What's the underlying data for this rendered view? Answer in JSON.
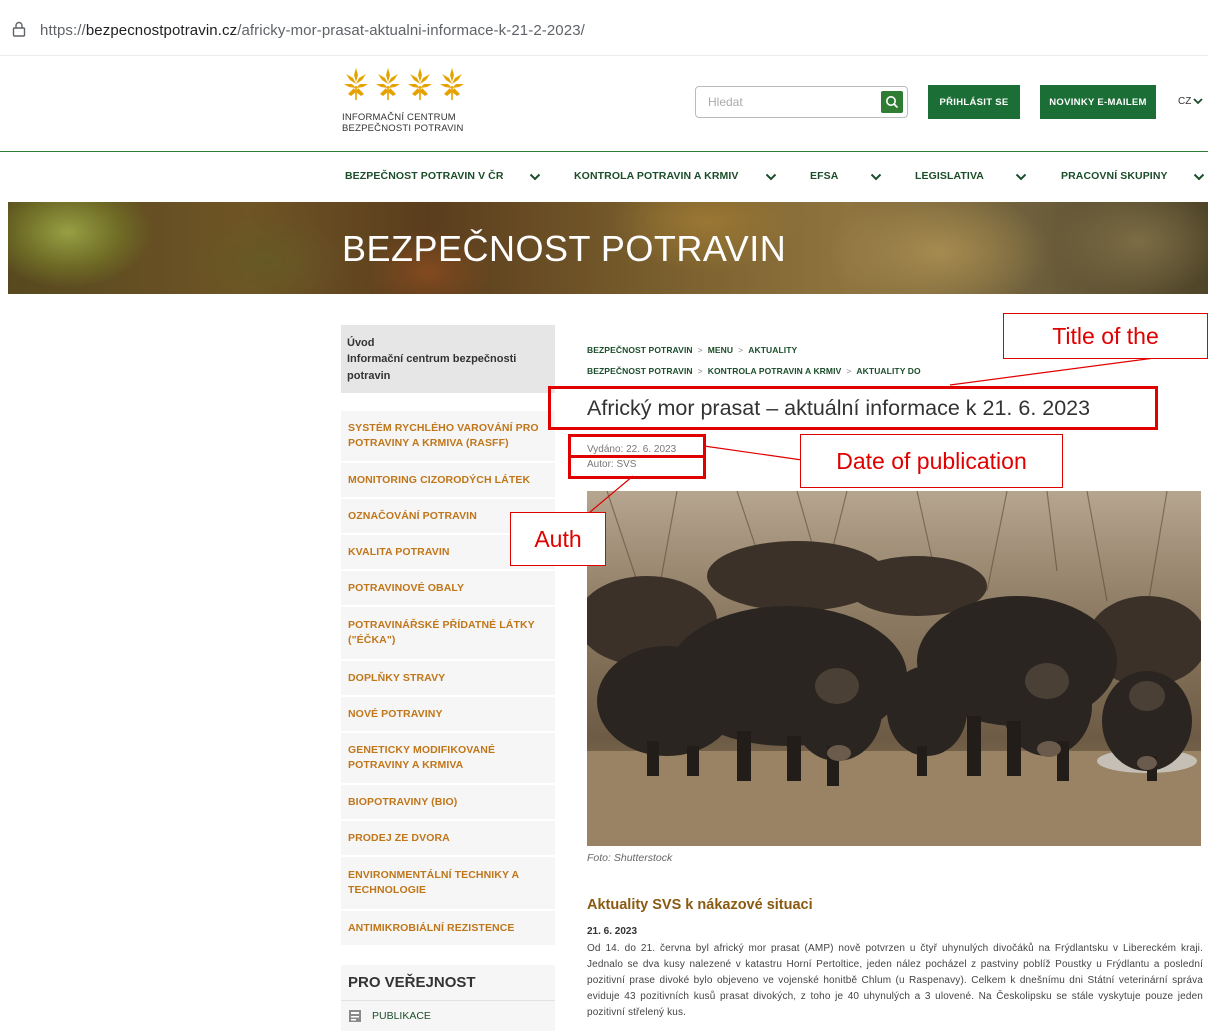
{
  "browser": {
    "url_prefix": "https://",
    "url_domain": "bezpecnostpotravin.cz",
    "url_path": "/africky-mor-prasat-aktualni-informace-k-21-2-2023/"
  },
  "header": {
    "logo_line1": "INFORMAČNÍ CENTRUM",
    "logo_line2": "BEZPEČNOSTI POTRAVIN",
    "search_placeholder": "Hledat",
    "login_label": "PŘIHLÁSIT SE",
    "newsletter_label": "NOVINKY E-MAILEM",
    "language": "CZ"
  },
  "nav": {
    "items": [
      "BEZPEČNOST POTRAVIN V ČR",
      "KONTROLA POTRAVIN A KRMIV",
      "EFSA",
      "LEGISLATIVA",
      "PRACOVNÍ SKUPINY"
    ]
  },
  "hero": {
    "title": "BEZPEČNOST POTRAVIN"
  },
  "sidebar": {
    "head_title": "Úvod",
    "head_subtitle": "Informační centrum bezpečnosti potravin",
    "items": [
      "SYSTÉM RYCHLÉHO VAROVÁNÍ PRO POTRAVINY A KRMIVA (RASFF)",
      "MONITORING CIZORODÝCH LÁTEK",
      "OZNAČOVÁNÍ POTRAVIN",
      "KVALITA POTRAVIN",
      "POTRAVINOVÉ OBALY",
      "POTRAVINÁŘSKÉ PŘÍDATNÉ LÁTKY (\"ÉČKA\")",
      "DOPLŇKY STRAVY",
      "NOVÉ POTRAVINY",
      "GENETICKY MODIFIKOVANÉ POTRAVINY A KRMIVA",
      "BIOPOTRAVINY (BIO)",
      "PRODEJ ZE DVORA",
      "ENVIRONMENTÁLNÍ TECHNIKY A TECHNOLOGIE",
      "ANTIMIKROBIÁLNÍ REZISTENCE"
    ],
    "public_title": "PRO VEŘEJNOST",
    "public_item": "PUBLIKACE"
  },
  "breadcrumbs": {
    "row1": [
      "BEZPEČNOST POTRAVIN",
      "MENU",
      "AKTUALITY"
    ],
    "row2": [
      "BEZPEČNOST POTRAVIN",
      "KONTROLA POTRAVIN A KRMIV",
      "AKTUALITY DO"
    ],
    "separator": ">"
  },
  "article": {
    "title": "Africký mor prasat – aktuální informace k 21. 6. 2023",
    "published": "Vydáno: 22. 6. 2023",
    "author": "Autor: SVS",
    "caption": "Foto: Shutterstock",
    "subheading": "Aktuality SVS k nákazové situaci",
    "para_date": "21. 6. 2023",
    "para_text": "Od 14. do 21. června byl africký mor prasat (AMP) nově potvrzen u čtyř uhynulých divočáků na Frýdlantsku v Libereckém kraji. Jednalo se dva kusy nalezené v katastru Horní Pertoltice, jeden nález pocházel z pastviny poblíž Poustky u Frýdlantu a poslední pozitivní prase divoké bylo objeveno ve vojenské honitbě Chlum (u Raspenavy). Celkem k dnešnímu dni Státní veterinární správa eviduje 43 pozitivních kusů prasat divokých, z toho je 40 uhynulých a 3 ulovené. Na Českolipsku se stále vyskytuje pouze jeden pozitivní střelený kus."
  },
  "annotations": {
    "title_label": "Title of the",
    "date_label": "Date of publication",
    "author_label": "Auth",
    "color": "#e00000"
  },
  "colors": {
    "brand_green": "#1b6e35",
    "nav_text": "#1b4d2a",
    "sidebar_orange": "#c0761a",
    "logo_orange": "#e5a100"
  }
}
